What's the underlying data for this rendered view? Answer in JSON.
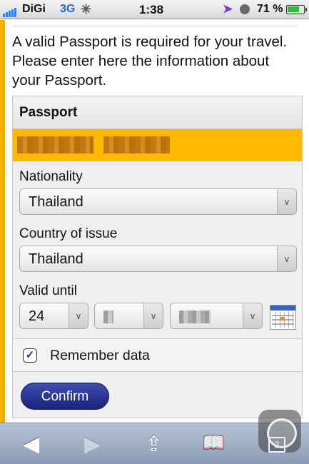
{
  "status_bar": {
    "carrier": "DiGi",
    "network": "3G",
    "time": "1:38",
    "battery_percent": "71 %",
    "battery_level": 0.71,
    "icons": [
      "signal-icon",
      "activity-spinner-icon",
      "location-icon",
      "clock-icon",
      "battery-icon"
    ]
  },
  "intro_text": "A valid Passport is required for your travel. Please enter here the information about your Passport.",
  "passport": {
    "title": "Passport",
    "nationality_label": "Nationality",
    "nationality_value": "Thailand",
    "country_label": "Country of issue",
    "country_value": "Thailand",
    "valid_label": "Valid until",
    "valid_day": "24",
    "remember_label": "Remember data",
    "remember_checked": true,
    "confirm_label": "Confirm"
  },
  "toolbar": {
    "back": "◀",
    "forward": "▶",
    "share": "⇪",
    "bookmarks": "📖",
    "pages_count": "2"
  },
  "colors": {
    "accent": "#f4b000",
    "highlight": "#ffb700",
    "button": "#1b237a"
  }
}
